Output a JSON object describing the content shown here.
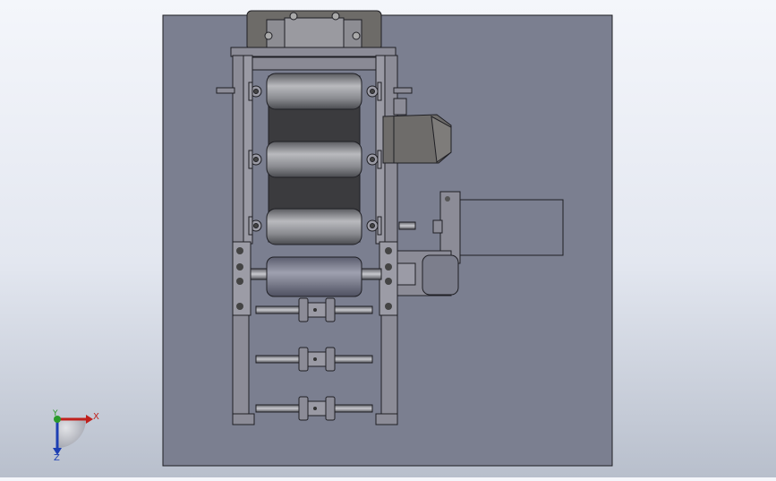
{
  "app": {
    "view": "front",
    "colors": {
      "background_top": "#f4f6fb",
      "background_bottom": "#b8bfcc",
      "base_plate": "#7b7f90",
      "frame": "#8c8c97",
      "edge": "#1f1f24",
      "roller": "#8a8b90",
      "belt": "#3b3b3e",
      "gearbox": "#6e6c6a",
      "axis_x": "#c0201c",
      "axis_y": "#2a9a2a",
      "axis_z": "#1d3fb3"
    }
  },
  "triad": {
    "x_label": "X",
    "y_label": "Y",
    "z_label": "Z"
  }
}
